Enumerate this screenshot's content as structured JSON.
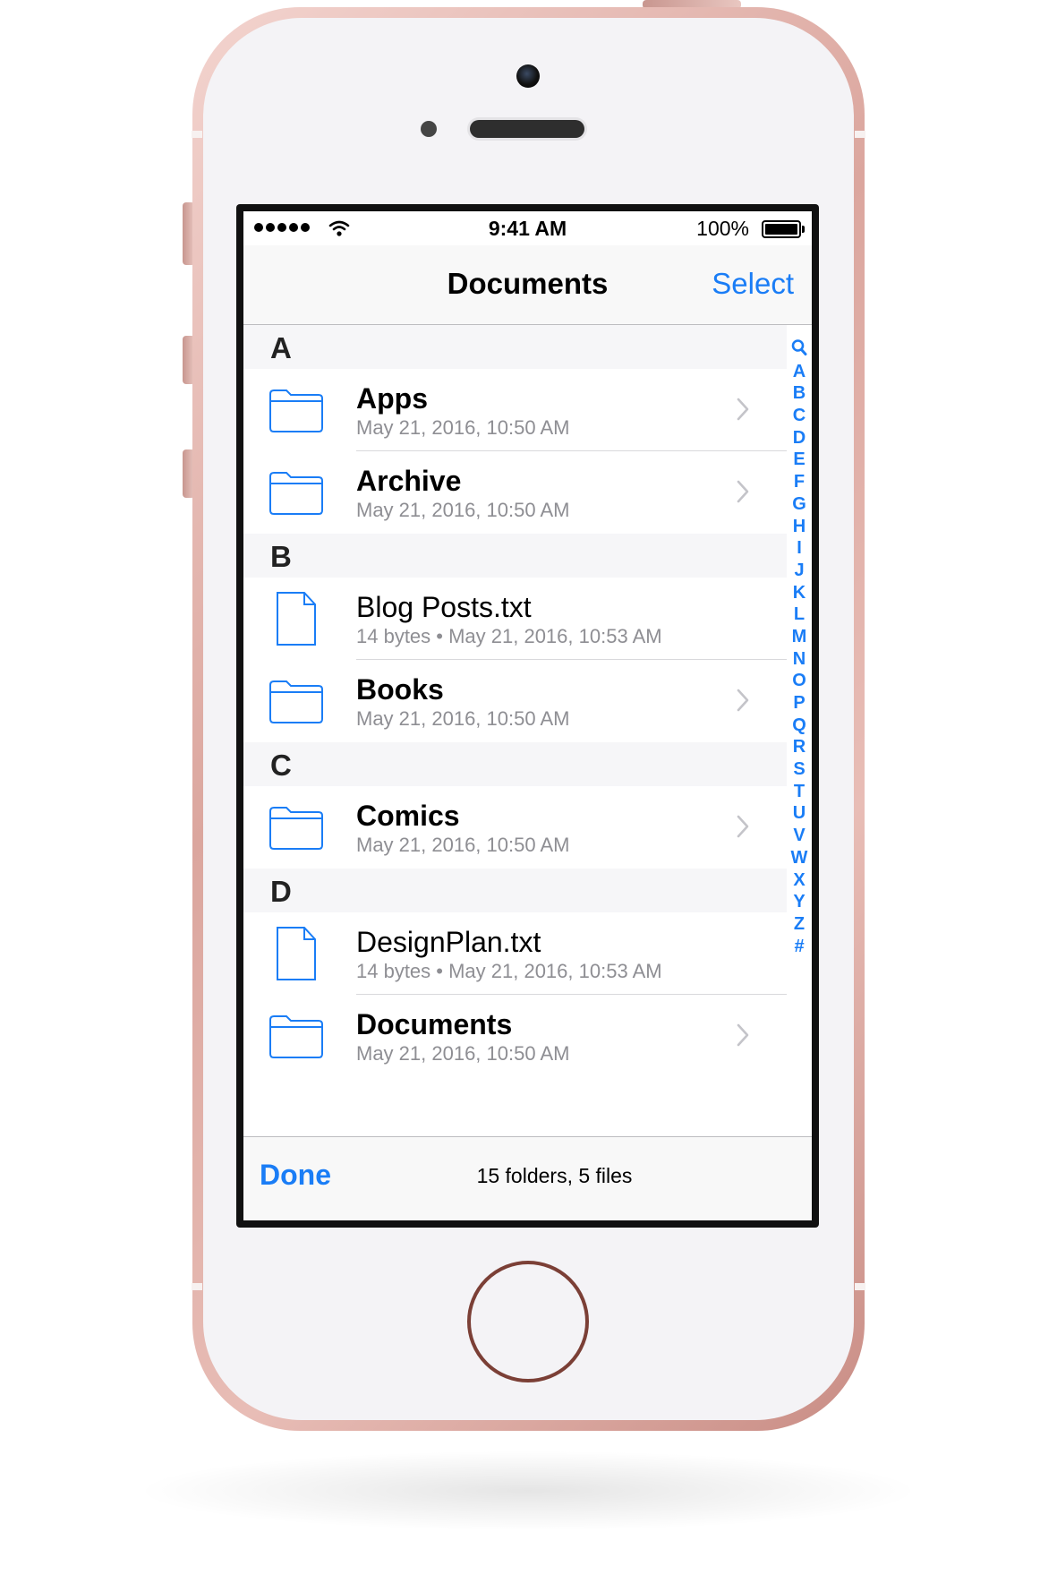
{
  "status_bar": {
    "time": "9:41 AM",
    "battery": "100%"
  },
  "nav": {
    "title": "Documents",
    "select_label": "Select"
  },
  "sections": [
    {
      "letter": "A",
      "items": [
        {
          "kind": "folder",
          "name": "Apps",
          "meta": "May 21, 2016, 10:50 AM"
        },
        {
          "kind": "folder",
          "name": "Archive",
          "meta": "May 21, 2016, 10:50 AM"
        }
      ]
    },
    {
      "letter": "B",
      "items": [
        {
          "kind": "file",
          "name": "Blog Posts.txt",
          "meta": "14 bytes • May 21, 2016, 10:53 AM"
        },
        {
          "kind": "folder",
          "name": "Books",
          "meta": "May 21, 2016, 10:50 AM"
        }
      ]
    },
    {
      "letter": "C",
      "items": [
        {
          "kind": "folder",
          "name": "Comics",
          "meta": "May 21, 2016, 10:50 AM"
        }
      ]
    },
    {
      "letter": "D",
      "items": [
        {
          "kind": "file",
          "name": "DesignPlan.txt",
          "meta": "14 bytes • May 21, 2016, 10:53 AM"
        },
        {
          "kind": "folder",
          "name": "Documents",
          "meta": "May 21, 2016, 10:50 AM"
        }
      ]
    }
  ],
  "section_index": [
    "search-icon",
    "A",
    "B",
    "C",
    "D",
    "E",
    "F",
    "G",
    "H",
    "I",
    "J",
    "K",
    "L",
    "M",
    "N",
    "O",
    "P",
    "Q",
    "R",
    "S",
    "T",
    "U",
    "V",
    "W",
    "X",
    "Y",
    "Z",
    "#"
  ],
  "toolbar": {
    "done_label": "Done",
    "summary": "15 folders, 5 files"
  },
  "colors": {
    "accent": "#1a7df6",
    "phone_body": "#e8bdb6",
    "section_bg": "#f6f6f8",
    "secondary_text": "#8e8e93"
  }
}
